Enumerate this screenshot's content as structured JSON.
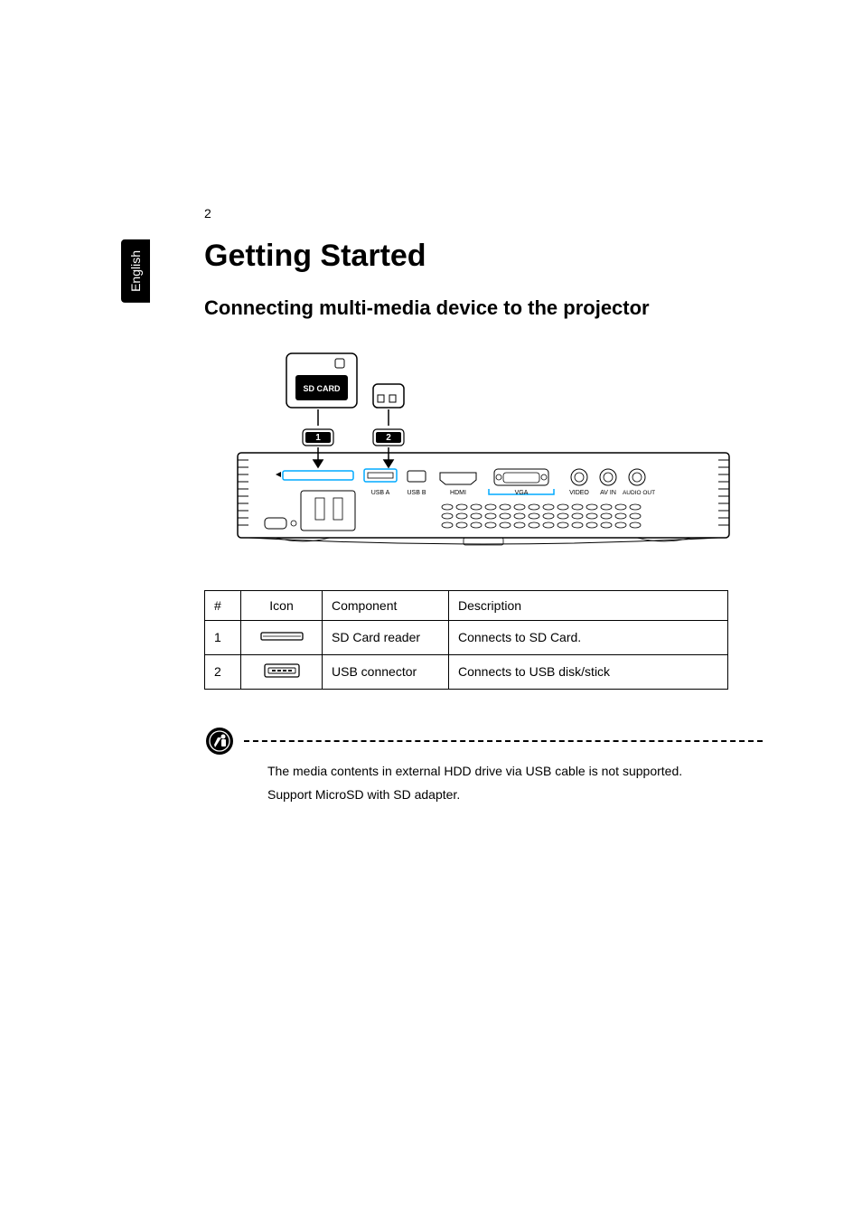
{
  "sidebar": {
    "language": "English"
  },
  "page_number": "2",
  "headings": {
    "h1": "Getting Started",
    "h2": "Connecting multi-media device to the projector"
  },
  "diagram": {
    "sd_card_label": "SD CARD",
    "callout_1": "1",
    "callout_2": "2",
    "port_labels": {
      "usb_a": "USB A",
      "usb_b": "USB B",
      "hdmi": "HDMI",
      "vga": "VGA",
      "video": "VIDEO",
      "av_in": "AV IN",
      "audio_out": "AUDIO OUT"
    }
  },
  "table": {
    "headers": {
      "num": "#",
      "icon": "Icon",
      "component": "Component",
      "description": "Description"
    },
    "rows": [
      {
        "num": "1",
        "component": "SD Card reader",
        "description": "Connects to SD Card."
      },
      {
        "num": "2",
        "component": "USB connector",
        "description": "Connects to USB disk/stick"
      }
    ]
  },
  "notes": {
    "line1": "The media contents in external HDD drive via USB cable is not supported.",
    "line2": "Support MicroSD with SD adapter."
  }
}
